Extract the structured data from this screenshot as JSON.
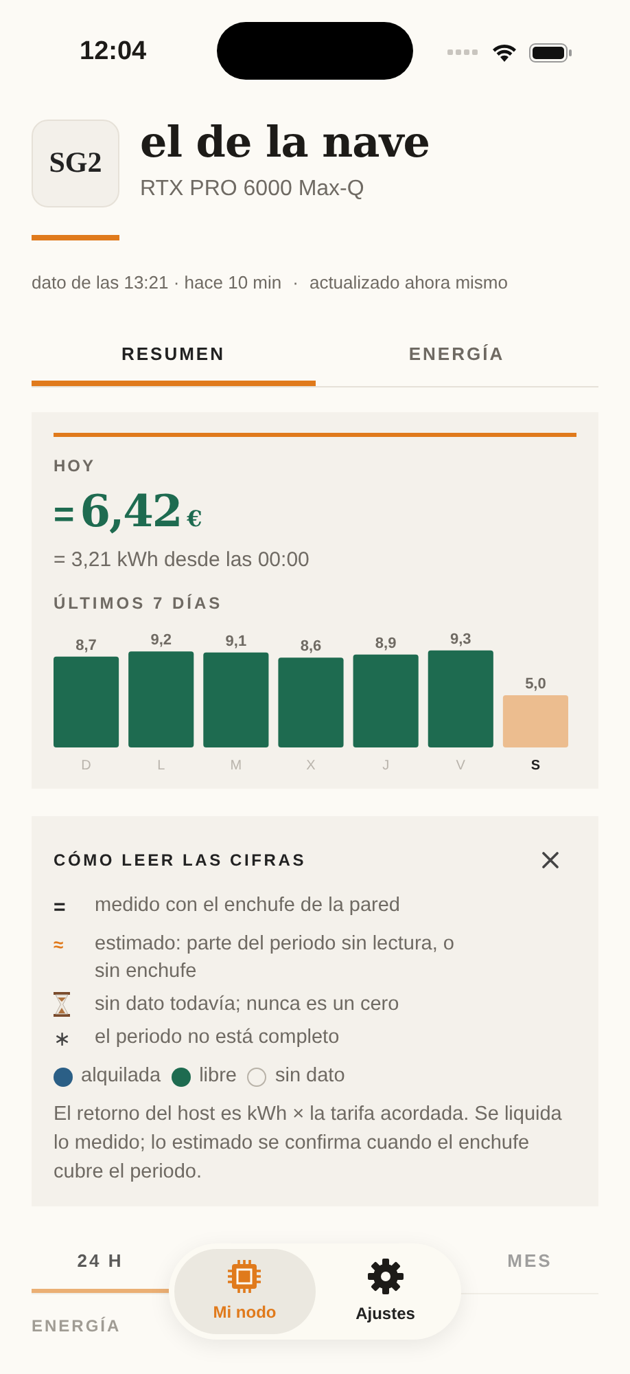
{
  "status_bar": {
    "time": "12:04"
  },
  "header": {
    "badge": "SG2",
    "title": "el de la nave",
    "subtitle": "RTX PRO 6000 Max-Q"
  },
  "meta": [
    "dato de las 13:21 · hace 10 min",
    "·",
    "actualizado ahora mismo"
  ],
  "tabs": [
    {
      "label": "RESUMEN",
      "selected": true
    },
    {
      "label": "ENERGÍA",
      "selected": false
    }
  ],
  "today": {
    "label": "HOY",
    "prefix": "=",
    "amount": "6,42",
    "currency": "€",
    "detail": "= 3,21 kWh desde las 00:00",
    "chart_title": "ÚLTIMOS 7 DÍAS",
    "bar_states": [
      {
        "kind": "complete"
      },
      {
        "kind": "complete"
      },
      {
        "kind": "complete"
      },
      {
        "kind": "complete"
      },
      {
        "kind": "complete"
      },
      {
        "kind": "complete"
      },
      {
        "kind": "partial"
      }
    ],
    "chart_data": {
      "type": "bar",
      "categories": [
        "D",
        "L",
        "M",
        "X",
        "J",
        "V",
        "S"
      ],
      "values": [
        8.7,
        9.2,
        9.1,
        8.6,
        8.9,
        9.3,
        5.0
      ],
      "value_labels": [
        "8,7",
        "9,2",
        "9,1",
        "8,6",
        "8,9",
        "9,3",
        "5,0"
      ]
    }
  },
  "legend": {
    "title": "CÓMO LEER LAS CIFRAS",
    "entries": [
      {
        "kind": "equals",
        "symbol": "=",
        "text": "medido con el enchufe de la pared"
      },
      {
        "kind": "approx",
        "symbol": "≈",
        "text": "estimado: parte del periodo sin lectura, o sin enchufe"
      },
      {
        "kind": "hourglass",
        "text": "sin dato todavía; nunca es un cero"
      },
      {
        "kind": "asterisk",
        "symbol": "∗",
        "text": "el periodo no está completo"
      }
    ],
    "dots": [
      {
        "label": "alquilada",
        "color": "#2b5f86",
        "filled": true
      },
      {
        "label": "libre",
        "color": "#1e6b50",
        "filled": true
      },
      {
        "label": "sin dato",
        "color": "#b8b2a8",
        "filled": false
      }
    ],
    "note": "El retorno del host es kWh × la tarifa acordada. Se liquida lo medido; lo estimado se confirma cuando el enchufe cubre el periodo."
  },
  "period_tabs": [
    {
      "label": "24 H",
      "selected": true
    },
    {
      "label": "MES",
      "selected": false
    }
  ],
  "section_label": "ENERGÍA",
  "nav": [
    {
      "label": "Mi nodo",
      "kind": "chip",
      "selected": true
    },
    {
      "label": "Ajustes",
      "kind": "gear",
      "selected": false
    }
  ]
}
